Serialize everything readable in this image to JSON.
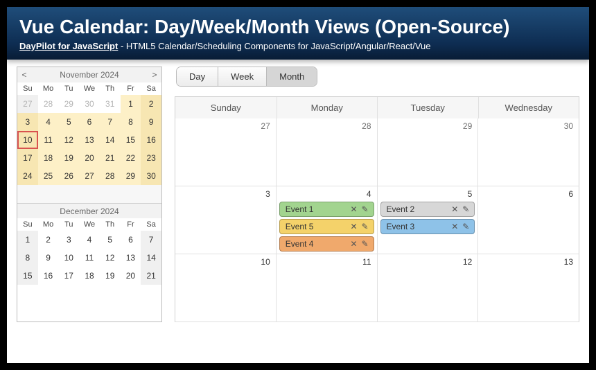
{
  "header": {
    "title": "Vue Calendar: Day/Week/Month Views (Open-Source)",
    "link_text": "DayPilot for JavaScript",
    "tagline": " - HTML5 Calendar/Scheduling Components for JavaScript/Angular/React/Vue"
  },
  "view_tabs": {
    "day": "Day",
    "week": "Week",
    "month": "Month",
    "active": "month"
  },
  "dow_short": [
    "Su",
    "Mo",
    "Tu",
    "We",
    "Th",
    "Fr",
    "Sa"
  ],
  "mini1": {
    "title": "November 2024",
    "prev": "<",
    "next": ">",
    "weeks": [
      [
        {
          "n": "27",
          "dim": true,
          "weekend": true
        },
        {
          "n": "28",
          "dim": true
        },
        {
          "n": "29",
          "dim": true
        },
        {
          "n": "30",
          "dim": true
        },
        {
          "n": "31",
          "dim": true
        },
        {
          "n": "1",
          "busy": true
        },
        {
          "n": "2",
          "busy": true,
          "weekend": true
        }
      ],
      [
        {
          "n": "3",
          "busy": true,
          "weekend": true
        },
        {
          "n": "4",
          "busy": true
        },
        {
          "n": "5",
          "busy": true
        },
        {
          "n": "6",
          "busy": true
        },
        {
          "n": "7",
          "busy": true
        },
        {
          "n": "8",
          "busy": true
        },
        {
          "n": "9",
          "busy": true,
          "weekend": true
        }
      ],
      [
        {
          "n": "10",
          "busy": true,
          "weekend": true,
          "today": true
        },
        {
          "n": "11",
          "busy": true
        },
        {
          "n": "12",
          "busy": true
        },
        {
          "n": "13",
          "busy": true
        },
        {
          "n": "14",
          "busy": true
        },
        {
          "n": "15",
          "busy": true
        },
        {
          "n": "16",
          "busy": true,
          "weekend": true
        }
      ],
      [
        {
          "n": "17",
          "busy": true,
          "weekend": true
        },
        {
          "n": "18",
          "busy": true
        },
        {
          "n": "19",
          "busy": true
        },
        {
          "n": "20",
          "busy": true
        },
        {
          "n": "21",
          "busy": true
        },
        {
          "n": "22",
          "busy": true
        },
        {
          "n": "23",
          "busy": true,
          "weekend": true
        }
      ],
      [
        {
          "n": "24",
          "busy": true,
          "weekend": true
        },
        {
          "n": "25",
          "busy": true
        },
        {
          "n": "26",
          "busy": true
        },
        {
          "n": "27",
          "busy": true
        },
        {
          "n": "28",
          "busy": true
        },
        {
          "n": "29",
          "busy": true
        },
        {
          "n": "30",
          "busy": true,
          "weekend": true
        }
      ],
      [
        {
          "n": "",
          "blank": true,
          "weekend": true
        },
        {
          "n": "",
          "blank": true
        },
        {
          "n": "",
          "blank": true
        },
        {
          "n": "",
          "blank": true
        },
        {
          "n": "",
          "blank": true
        },
        {
          "n": "",
          "blank": true
        },
        {
          "n": "",
          "blank": true,
          "weekend": true
        }
      ]
    ]
  },
  "mini2": {
    "title": "December 2024",
    "weeks": [
      [
        {
          "n": "1",
          "weekend": true
        },
        {
          "n": "2"
        },
        {
          "n": "3"
        },
        {
          "n": "4"
        },
        {
          "n": "5"
        },
        {
          "n": "6"
        },
        {
          "n": "7",
          "weekend": true
        }
      ],
      [
        {
          "n": "8",
          "weekend": true
        },
        {
          "n": "9"
        },
        {
          "n": "10"
        },
        {
          "n": "11"
        },
        {
          "n": "12"
        },
        {
          "n": "13"
        },
        {
          "n": "14",
          "weekend": true
        }
      ],
      [
        {
          "n": "15",
          "weekend": true
        },
        {
          "n": "16"
        },
        {
          "n": "17"
        },
        {
          "n": "18"
        },
        {
          "n": "19"
        },
        {
          "n": "20"
        },
        {
          "n": "21",
          "weekend": true
        }
      ]
    ]
  },
  "month": {
    "dow": [
      "Sunday",
      "Monday",
      "Tuesday",
      "Wednesday"
    ],
    "rows": [
      [
        {
          "n": "27",
          "muted": true
        },
        {
          "n": "28",
          "muted": true
        },
        {
          "n": "29",
          "muted": true
        },
        {
          "n": "30",
          "muted": true
        }
      ],
      [
        {
          "n": "3"
        },
        {
          "n": "4",
          "events": [
            {
              "label": "Event 1",
              "color": "green"
            },
            {
              "label": "Event 5",
              "color": "yellow"
            },
            {
              "label": "Event 4",
              "color": "orange"
            }
          ]
        },
        {
          "n": "5",
          "events": [
            {
              "label": "Event 2",
              "color": "gray"
            },
            {
              "label": "Event 3",
              "color": "blue"
            }
          ]
        },
        {
          "n": "6"
        }
      ],
      [
        {
          "n": "10"
        },
        {
          "n": "11"
        },
        {
          "n": "12"
        },
        {
          "n": "13"
        }
      ]
    ]
  }
}
